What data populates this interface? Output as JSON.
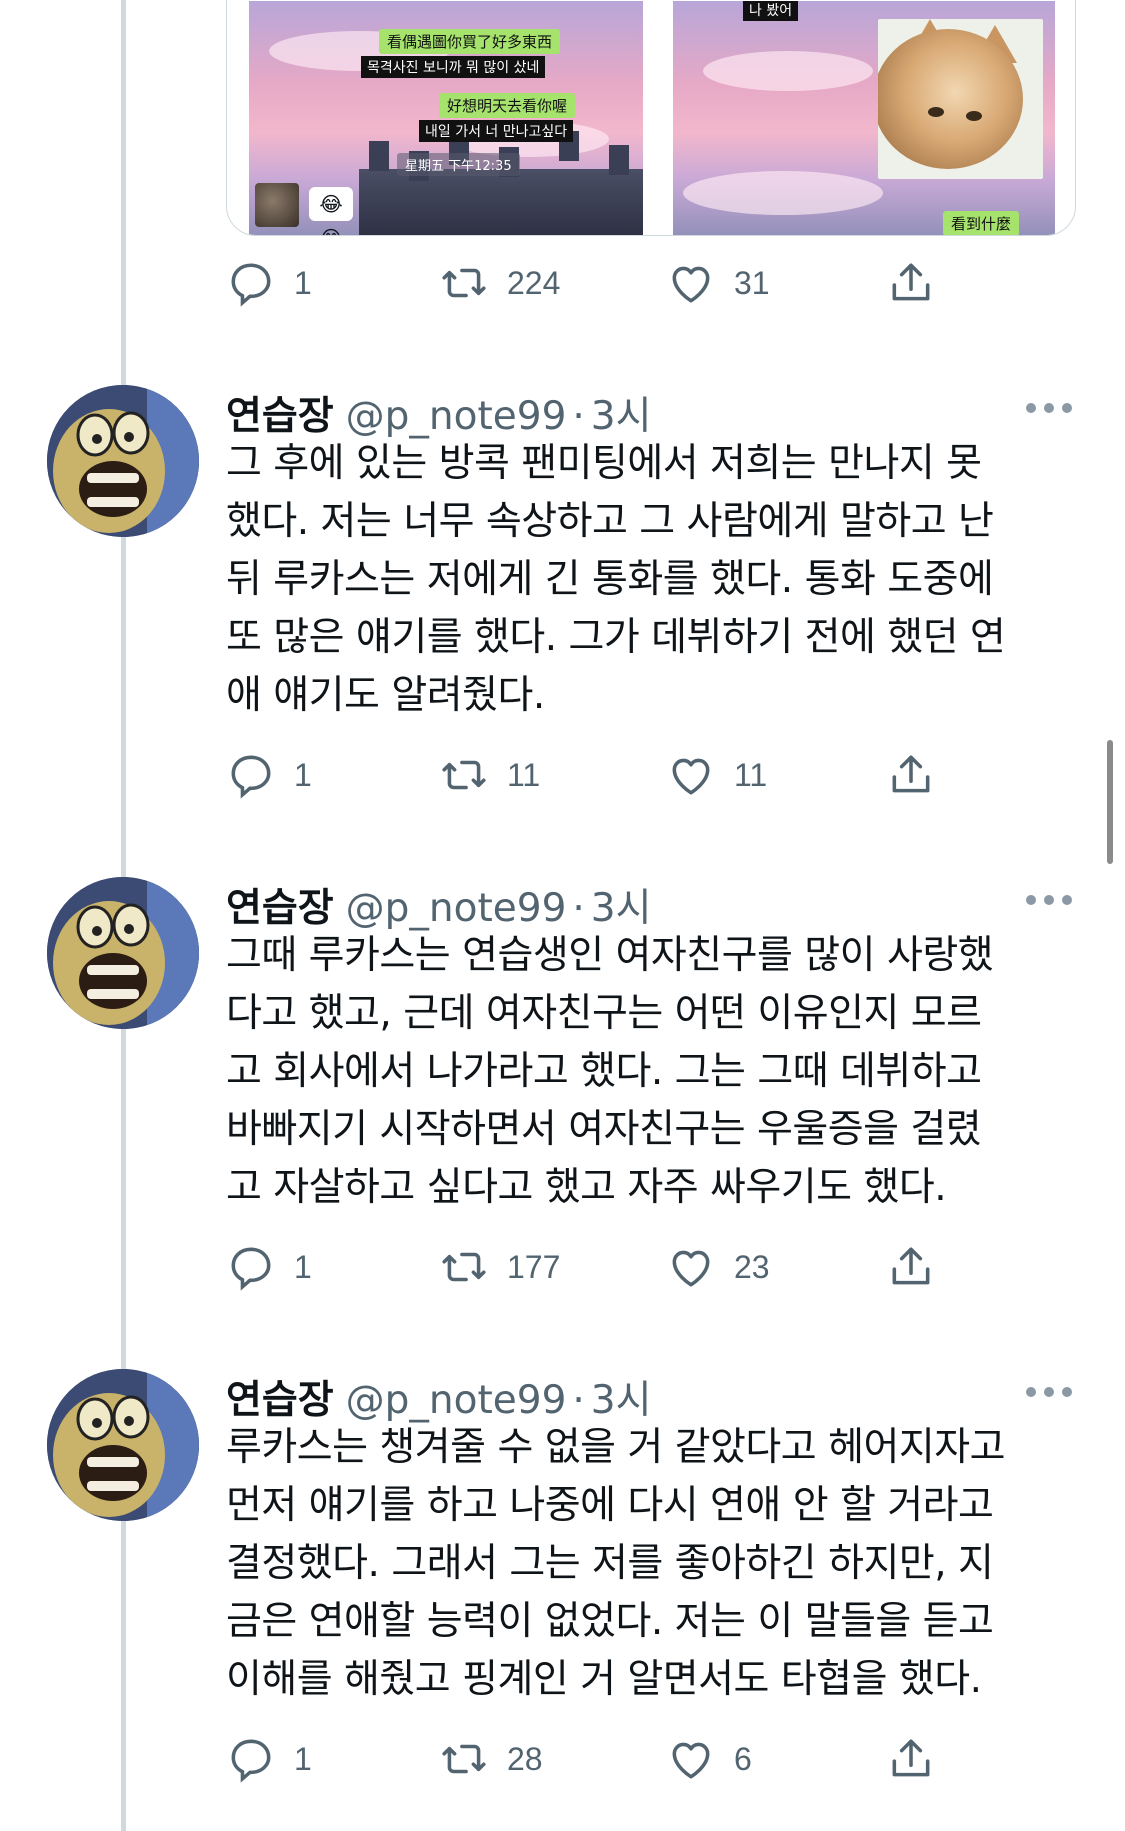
{
  "media": {
    "left_shot": {
      "lines": [
        {
          "type": "bubble",
          "text": "看偶遇圖你買了好多東西"
        },
        {
          "type": "sub",
          "text": "목격사진 보니까 뭐 많이 샀네"
        },
        {
          "type": "bubble",
          "text": "好想明天去看你喔"
        },
        {
          "type": "sub",
          "text": "내일 가서 너 만나고싶다"
        }
      ],
      "timestamp": "星期五 下午12:35",
      "emoji": "😂😂"
    },
    "right_shot": {
      "top_sub": "나 봤어",
      "bubble": "看到什麼"
    }
  },
  "top_actions": {
    "reply": "1",
    "retweet": "224",
    "like": "31"
  },
  "tweets": [
    {
      "name": "연습장",
      "handle": "@p_note99",
      "dot": "·",
      "time": "3시",
      "text": "그 후에 있는 방콕 팬미팅에서 저희는 만나지 못\n했다. 저는 너무 속상하고 그 사람에게 말하고 난\n뒤 루카스는 저에게 긴 통화를 했다. 통화 도중에\n또 많은 얘기를 했다. 그가 데뷔하기 전에 했던 연\n애 얘기도 알려줬다.",
      "reply": "1",
      "retweet": "11",
      "like": "11"
    },
    {
      "name": "연습장",
      "handle": "@p_note99",
      "dot": "·",
      "time": "3시",
      "text": "그때 루카스는 연습생인 여자친구를 많이 사랑했\n다고 했고, 근데 여자친구는 어떤 이유인지 모르\n고 회사에서 나가라고 했다. 그는 그때 데뷔하고\n바빠지기 시작하면서 여자친구는 우울증을 걸렸\n고 자살하고 싶다고 했고 자주 싸우기도 했다.",
      "reply": "1",
      "retweet": "177",
      "like": "23"
    },
    {
      "name": "연습장",
      "handle": "@p_note99",
      "dot": "·",
      "time": "3시",
      "text": "루카스는 챙겨줄 수 없을 거 같았다고 헤어지자고\n먼저 얘기를 하고 나중에 다시 연애 안 할 거라고\n결정했다. 그래서 그는 저를 좋아하긴 하지만, 지\n금은 연애할 능력이 없었다. 저는 이 말들을 듣고\n이해를 해줬고 핑계인 거 알면서도 타협을 했다.",
      "reply": "1",
      "retweet": "28",
      "like": "6"
    }
  ],
  "colors": {
    "text": "#0f1419",
    "muted": "#536471",
    "line": "#cfd9de"
  }
}
